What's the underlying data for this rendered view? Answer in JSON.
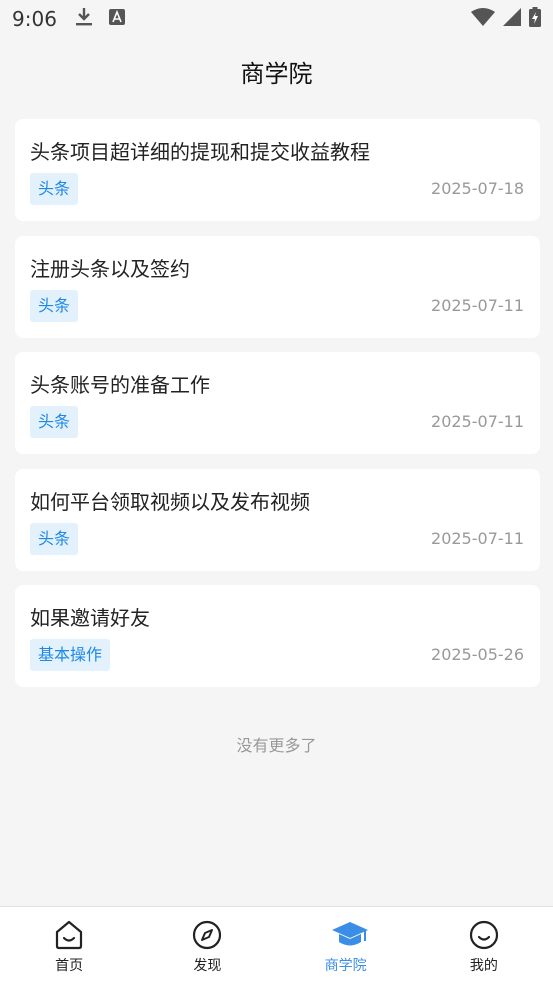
{
  "status_bar": {
    "time": "9:06"
  },
  "header": {
    "title": "商学院"
  },
  "articles": [
    {
      "title": "头条项目超详细的提现和提交收益教程",
      "tag": "头条",
      "date": "2025-07-18"
    },
    {
      "title": "注册头条以及签约",
      "tag": "头条",
      "date": "2025-07-11"
    },
    {
      "title": "头条账号的准备工作",
      "tag": "头条",
      "date": "2025-07-11"
    },
    {
      "title": "如何平台领取视频以及发布视频",
      "tag": "头条",
      "date": "2025-07-11"
    },
    {
      "title": "如果邀请好友",
      "tag": "基本操作",
      "date": "2025-05-26"
    }
  ],
  "footer_text": "没有更多了",
  "tabbar": {
    "items": [
      {
        "label": "首页",
        "icon": "home-icon"
      },
      {
        "label": "发现",
        "icon": "compass-icon"
      },
      {
        "label": "商学院",
        "icon": "graduation-cap-icon",
        "active": true
      },
      {
        "label": "我的",
        "icon": "smile-icon"
      }
    ]
  },
  "colors": {
    "accent": "#3a8ee6",
    "tag_bg": "#e3f1fd",
    "tag_text": "#1e88e5"
  }
}
